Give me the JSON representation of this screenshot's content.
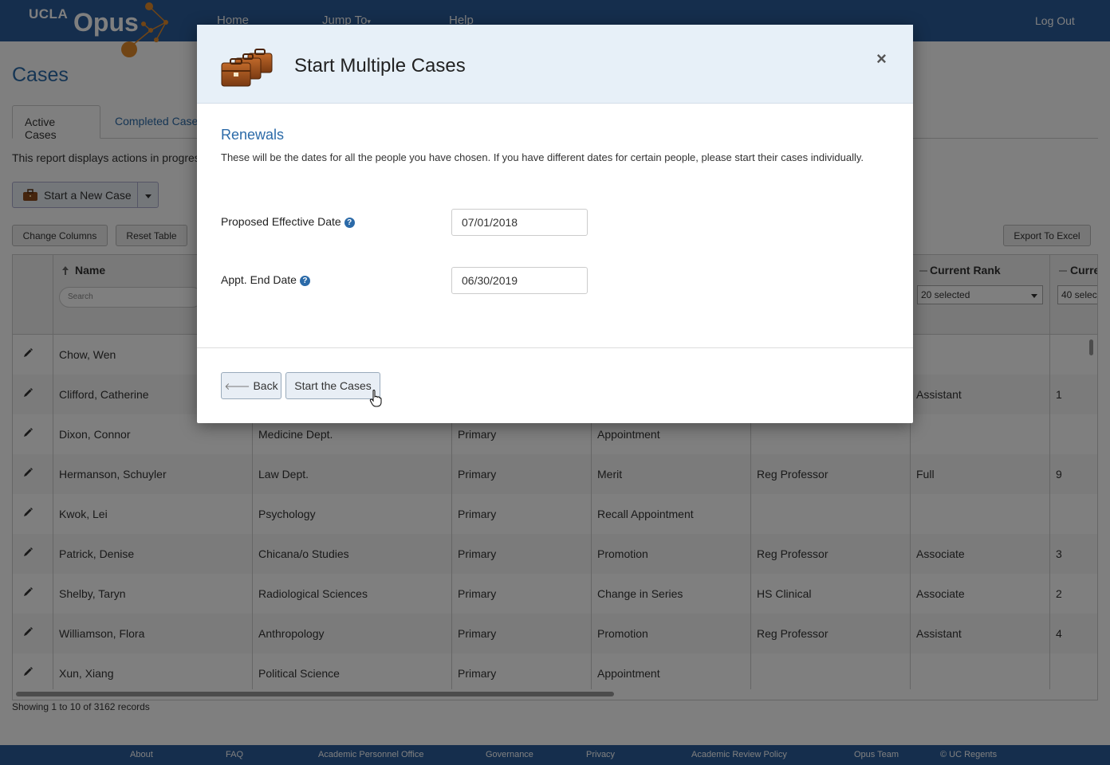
{
  "nav": {
    "logo_ucla": "UCLA",
    "logo_opus": "Opus",
    "home": "Home",
    "jump_to": "Jump To",
    "help": "Help",
    "logout": "Log Out"
  },
  "page": {
    "title": "Cases",
    "tabs": [
      "Active Cases",
      "Completed Cases"
    ],
    "description": "This report displays actions in progress",
    "new_case_label": "Start a New Case",
    "change_columns": "Change Columns",
    "reset_table": "Reset Table",
    "export": "Export To Excel",
    "showing": "Showing 1 to 10 of 3162 records"
  },
  "table": {
    "headers": {
      "name": "Name",
      "search_placeholder": "Search",
      "current_rank": "Current Rank",
      "current_step": "Curre",
      "rank_filter": "20 selected",
      "step_filter": "40 selec"
    },
    "rows": [
      {
        "name": "Chow, Wen",
        "dept": "",
        "appt": "",
        "action": "",
        "series": "",
        "rank": "",
        "step": ""
      },
      {
        "name": "Clifford, Catherine",
        "dept": "",
        "appt": "",
        "action": "",
        "series": "",
        "rank": "Assistant",
        "step": "1"
      },
      {
        "name": "Dixon, Connor",
        "dept": "Medicine Dept.",
        "appt": "Primary",
        "action": "Appointment",
        "series": "",
        "rank": "",
        "step": ""
      },
      {
        "name": "Hermanson, Schuyler",
        "dept": "Law Dept.",
        "appt": "Primary",
        "action": "Merit",
        "series": "Reg Professor",
        "rank": "Full",
        "step": "9"
      },
      {
        "name": "Kwok, Lei",
        "dept": "Psychology",
        "appt": "Primary",
        "action": "Recall Appointment",
        "series": "",
        "rank": "",
        "step": ""
      },
      {
        "name": "Patrick, Denise",
        "dept": "Chicana/o Studies",
        "appt": "Primary",
        "action": "Promotion",
        "series": "Reg Professor",
        "rank": "Associate",
        "step": "3"
      },
      {
        "name": "Shelby, Taryn",
        "dept": "Radiological Sciences",
        "appt": "Primary",
        "action": "Change in Series",
        "series": "HS Clinical",
        "rank": "Associate",
        "step": "2"
      },
      {
        "name": "Williamson, Flora",
        "dept": "Anthropology",
        "appt": "Primary",
        "action": "Promotion",
        "series": "Reg Professor",
        "rank": "Assistant",
        "step": "4"
      },
      {
        "name": "Xun, Xiang",
        "dept": "Political Science",
        "appt": "Primary",
        "action": "Appointment",
        "series": "",
        "rank": "",
        "step": ""
      }
    ]
  },
  "footer": [
    "About",
    "FAQ",
    "Academic Personnel Office",
    "Governance",
    "Privacy",
    "Academic Review Policy",
    "Opus Team",
    "© UC Regents"
  ],
  "modal": {
    "title": "Start Multiple Cases",
    "close": "×",
    "section": "Renewals",
    "description": "These will be the dates for all the people you have chosen. If you have different dates for certain people, please start their cases individually.",
    "effective_label": "Proposed Effective Date",
    "effective_value": "07/01/2018",
    "end_label": "Appt. End Date",
    "end_value": "06/30/2019",
    "help_glyph": "?",
    "back": "Back",
    "start": "Start the Cases"
  },
  "colors": {
    "brand": "#2b5d9b",
    "link": "#2b6aa8",
    "modal_header": "#e7f0f8"
  }
}
